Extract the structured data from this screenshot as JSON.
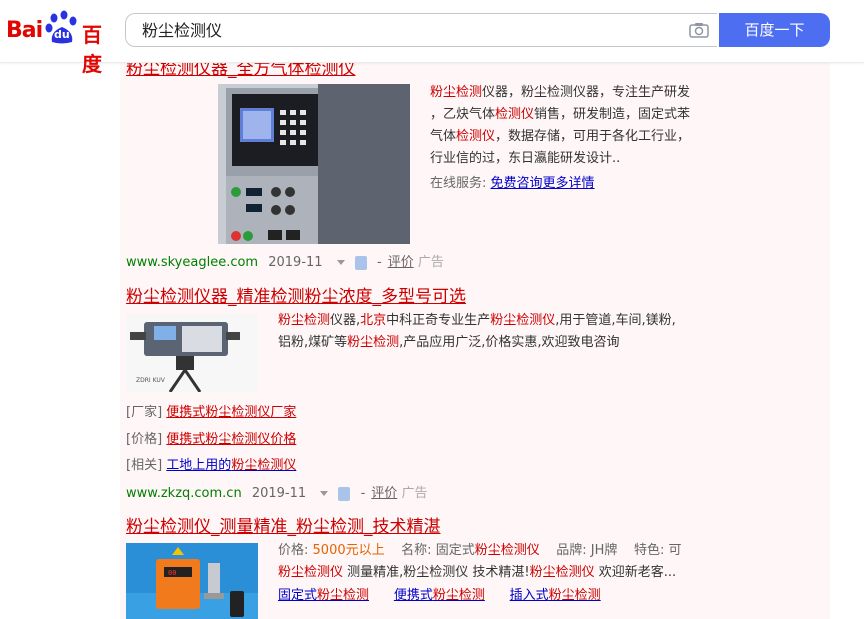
{
  "header": {
    "logo_text_bai": "Bai",
    "logo_text_du": "du",
    "logo_text_cn": "百度",
    "query": "粉尘检测仪",
    "search_button": "百度一下",
    "camera_icon": "camera-icon"
  },
  "results": [
    {
      "title": "粉尘检测仪器_全方气体检测仪",
      "desc_lines": [
        [
          {
            "t": "粉尘检测",
            "c": "red"
          },
          {
            "t": "仪器，粉尘检测仪器，专注生产研发",
            "c": ""
          }
        ],
        [
          {
            "t": "，乙炔气体",
            "c": ""
          },
          {
            "t": "检测仪",
            "c": "red"
          },
          {
            "t": "销售，研发制造，固定式苯",
            "c": ""
          }
        ],
        [
          {
            "t": "气体",
            "c": ""
          },
          {
            "t": "检测仪",
            "c": "red"
          },
          {
            "t": "，数据存储，可用于各化工行业，",
            "c": ""
          }
        ],
        [
          {
            "t": "行业信的过，东日瀛能研发设计..",
            "c": ""
          }
        ]
      ],
      "service_label": "在线服务:",
      "service_link": "免费咨询更多详情",
      "url": "www.skyeaglee.com",
      "date": "2019-11",
      "review": "评价",
      "ad": "广告"
    },
    {
      "title": "粉尘检测仪器_精准检测粉尘浓度_多型号可选",
      "desc_lines": [
        [
          {
            "t": "粉尘检测",
            "c": "red"
          },
          {
            "t": "仪器,",
            "c": ""
          },
          {
            "t": "北京",
            "c": "red"
          },
          {
            "t": "中科正奇专业生产",
            "c": ""
          },
          {
            "t": "粉尘检测仪",
            "c": "red"
          },
          {
            "t": ",用于管道,车间,镁粉,",
            "c": ""
          }
        ],
        [
          {
            "t": "铝粉,煤矿等",
            "c": ""
          },
          {
            "t": "粉尘检测",
            "c": "red"
          },
          {
            "t": ",产品应用广泛,价格实惠,欢迎致电咨询",
            "c": ""
          }
        ]
      ],
      "sub_links": [
        {
          "label": "[厂家]",
          "link_pre": "便携式",
          "link_em": "粉尘检测仪",
          "link_post": "厂家"
        },
        {
          "label": "[价格]",
          "link_pre": "便携式",
          "link_em": "粉尘检测仪",
          "link_post": "价格"
        },
        {
          "label": "[相关]",
          "link_pre": "工地上用的",
          "link_em": "粉尘检测仪",
          "link_post": ""
        }
      ],
      "url": "www.zkzq.com.cn",
      "date": "2019-11",
      "review": "评价",
      "ad": "广告"
    },
    {
      "title": "粉尘检测仪_测量精准_粉尘检测_技术精湛",
      "price_label": "价格:",
      "price": "5000元以上",
      "name_label": "名称:",
      "name_pre": "固定式",
      "name_em": "粉尘检测仪",
      "brand_label": "品牌:",
      "brand": "JH牌",
      "feature_label": "特色:",
      "feature": "可",
      "desc_line": [
        {
          "t": "粉尘检测仪",
          "c": "red"
        },
        {
          "t": " 测量精准,粉尘检测仪 技术精湛!",
          "c": ""
        },
        {
          "t": "粉尘检测仪",
          "c": "red"
        },
        {
          "t": " 欢迎新老客...",
          "c": ""
        }
      ],
      "links": [
        {
          "pre": "固定式",
          "em": "粉尘检测"
        },
        {
          "pre": "便携式",
          "em": "粉尘检测"
        },
        {
          "pre": "插入式",
          "em": "粉尘检测"
        }
      ]
    }
  ]
}
